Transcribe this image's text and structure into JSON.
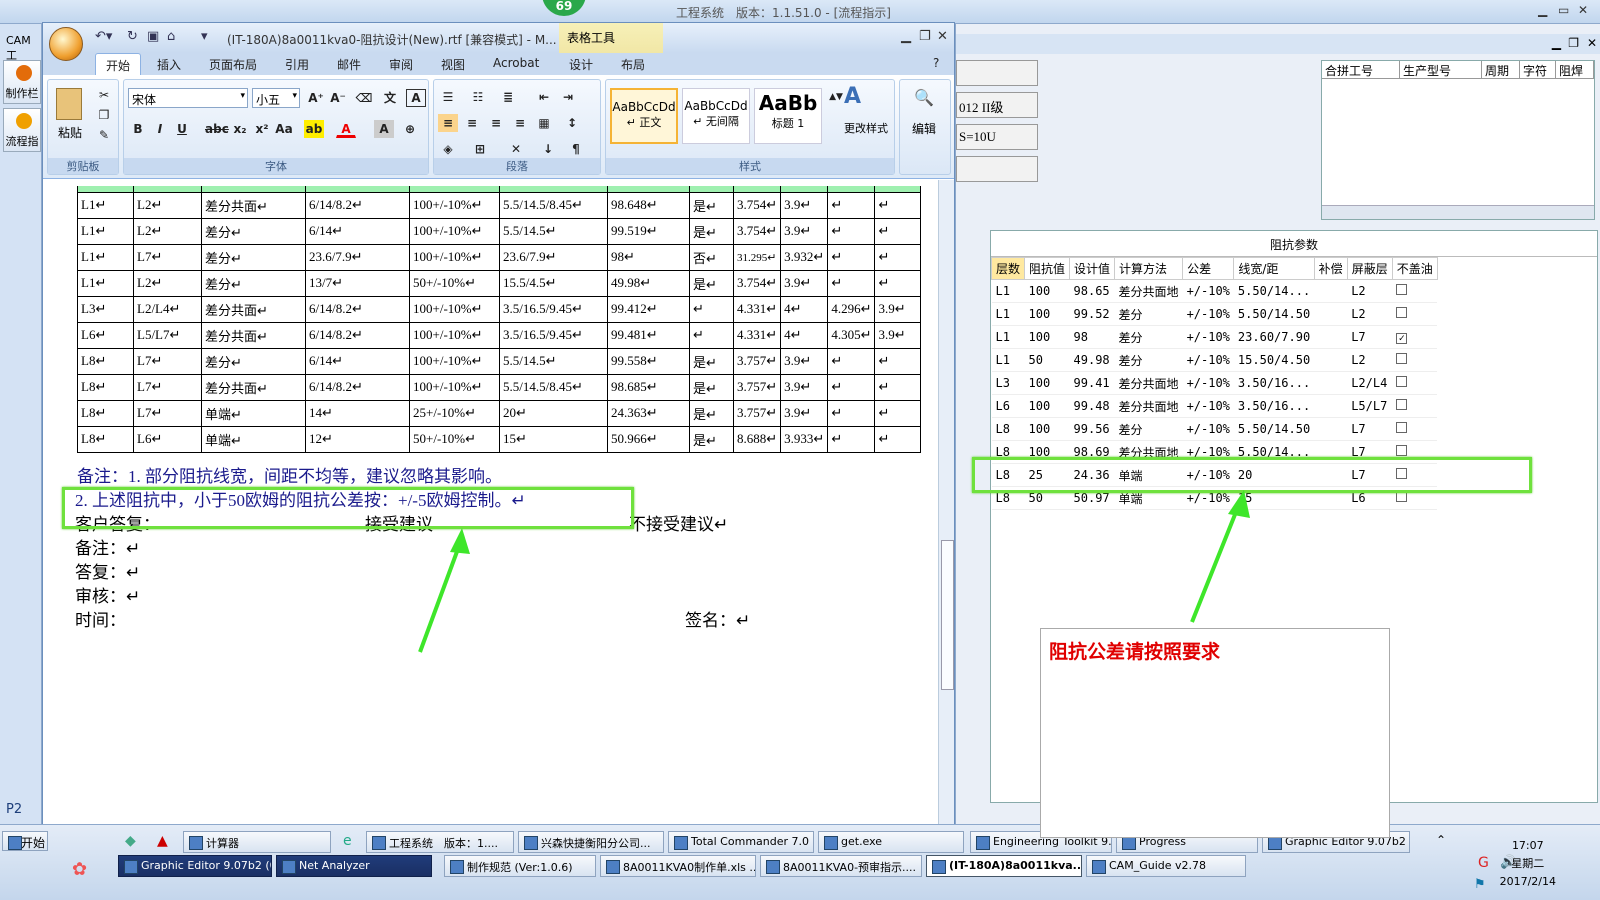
{
  "badge": "69",
  "cam": {
    "title": "工程系统　版本：1.1.51.0 - [流程指示]",
    "app_label": "CAM工",
    "side_buttons": [
      "制作栏",
      "流程指"
    ],
    "page_label": "P2",
    "fields": [
      "",
      "012 II级",
      "S=10U",
      ""
    ],
    "merge_headers": [
      "合拼工号",
      "生产型号",
      "周期",
      "字符",
      "阻焊"
    ],
    "imp_caption": "阻抗参数",
    "imp_headers": [
      "层数",
      "阻抗值",
      "设计值",
      "计算方法",
      "公差",
      "线宽/距",
      "补偿",
      "屏蔽层",
      "不盖油"
    ],
    "imp_rows": [
      [
        "L1",
        "100",
        "98.65",
        "差分共面地",
        "+/-10%",
        "5.50/14...",
        "",
        "L2",
        false
      ],
      [
        "L1",
        "100",
        "99.52",
        "差分",
        "+/-10%",
        "5.50/14.50",
        "",
        "L2",
        false
      ],
      [
        "L1",
        "100",
        "98",
        "差分",
        "+/-10%",
        "23.60/7.90",
        "",
        "L7",
        true
      ],
      [
        "L1",
        "50",
        "49.98",
        "差分",
        "+/-10%",
        "15.50/4.50",
        "",
        "L2",
        false
      ],
      [
        "L3",
        "100",
        "99.41",
        "差分共面地",
        "+/-10%",
        "3.50/16...",
        "",
        "L2/L4",
        false
      ],
      [
        "L6",
        "100",
        "99.48",
        "差分共面地",
        "+/-10%",
        "3.50/16...",
        "",
        "L5/L7",
        false
      ],
      [
        "L8",
        "100",
        "99.56",
        "差分",
        "+/-10%",
        "5.50/14.50",
        "",
        "L7",
        false
      ],
      [
        "L8",
        "100",
        "98.69",
        "差分共面地",
        "+/-10%",
        "5.50/14...",
        "",
        "L7",
        false
      ],
      [
        "L8",
        "25",
        "24.36",
        "单端",
        "+/-10%",
        "20",
        "",
        "L7",
        false
      ],
      [
        "L8",
        "50",
        "50.97",
        "单端",
        "+/-10%",
        "15",
        "",
        "L6",
        false
      ]
    ]
  },
  "word": {
    "title": "(IT-180A)8a0011kva0-阻抗设计(New).rtf [兼容模式] - M...",
    "tools_label": "表格工具",
    "tabs": [
      "开始",
      "插入",
      "页面布局",
      "引用",
      "邮件",
      "审阅",
      "视图",
      "Acrobat",
      "设计",
      "布局"
    ],
    "font_name": "宋体",
    "font_size": "小五",
    "groups": {
      "clipboard": "剪贴板",
      "font": "字体",
      "paragraph": "段落",
      "styles": "样式",
      "edit": "编辑"
    },
    "paste_label": "粘贴",
    "change_styles": "更改样式",
    "styles": [
      {
        "preview": "AaBbCcDd",
        "name": "↵ 正文"
      },
      {
        "preview": "AaBbCcDd",
        "name": "↵ 无间隔"
      },
      {
        "preview": "AaBb",
        "name": "标题 1"
      }
    ],
    "table_rows": [
      [
        "L1↵",
        "L2↵",
        "差分共面↵",
        "6/14/8.2↵",
        "100+/-10%↵",
        "5.5/14.5/8.45↵",
        "98.648↵",
        "是↵",
        "3.754↵",
        "3.9↵",
        "↵",
        "↵"
      ],
      [
        "L1↵",
        "L2↵",
        "差分↵",
        "6/14↵",
        "100+/-10%↵",
        "5.5/14.5↵",
        "99.519↵",
        "是↵",
        "3.754↵",
        "3.9↵",
        "↵",
        "↵"
      ],
      [
        "L1↵",
        "L7↵",
        "差分↵",
        "23.6/7.9↵",
        "100+/-10%↵",
        "23.6/7.9↵",
        "98↵",
        "否↵",
        "31.295↵",
        "3.932↵",
        "↵",
        "↵"
      ],
      [
        "L1↵",
        "L2↵",
        "差分↵",
        "13/7↵",
        "50+/-10%↵",
        "15.5/4.5↵",
        "49.98↵",
        "是↵",
        "3.754↵",
        "3.9↵",
        "↵",
        "↵"
      ],
      [
        "L3↵",
        "L2/L4↵",
        "差分共面↵",
        "6/14/8.2↵",
        "100+/-10%↵",
        "3.5/16.5/9.45↵",
        "99.412↵",
        "↵",
        "4.331↵",
        "4↵",
        "4.296↵",
        "3.9↵"
      ],
      [
        "L6↵",
        "L5/L7↵",
        "差分共面↵",
        "6/14/8.2↵",
        "100+/-10%↵",
        "3.5/16.5/9.45↵",
        "99.481↵",
        "↵",
        "4.331↵",
        "4↵",
        "4.305↵",
        "3.9↵"
      ],
      [
        "L8↵",
        "L7↵",
        "差分↵",
        "6/14↵",
        "100+/-10%↵",
        "5.5/14.5↵",
        "99.558↵",
        "是↵",
        "3.757↵",
        "3.9↵",
        "↵",
        "↵"
      ],
      [
        "L8↵",
        "L7↵",
        "差分共面↵",
        "6/14/8.2↵",
        "100+/-10%↵",
        "5.5/14.5/8.45↵",
        "98.685↵",
        "是↵",
        "3.757↵",
        "3.9↵",
        "↵",
        "↵"
      ],
      [
        "L8↵",
        "L7↵",
        "单端↵",
        "14↵",
        "25+/-10%↵",
        "20↵",
        "24.363↵",
        "是↵",
        "3.757↵",
        "3.9↵",
        "↵",
        "↵"
      ],
      [
        "L8↵",
        "L6↵",
        "单端↵",
        "12↵",
        "50+/-10%↵",
        "15↵",
        "50.966↵",
        "是↵",
        "8.688↵",
        "3.933↵",
        "↵",
        "↵"
      ]
    ],
    "note1": "备注：1. 部分阻抗线宽，间距不均等，建议忽略其影响。",
    "note2": "2. 上述阻抗中，小于50欧姆的阻抗公差按：+/-5欧姆控制。↵",
    "reply": "客户答复：",
    "accept": "接受建议",
    "reject": "不接受建议↵",
    "remark": "备注：↵",
    "answer": "答复：↵",
    "review": "审核：↵",
    "time": "时间：",
    "sign": "签名：↵"
  },
  "annotation": {
    "text": "阻抗公差请按照要求",
    "color": "#e00000",
    "box_color": "#6fe13d",
    "arrow_color": "#3ee62a"
  },
  "taskbar": {
    "start": "开始",
    "row1": [
      "计算器",
      "工程系统　版本：1....",
      "兴森快捷衡阳分公司...",
      "Total Commander 7.0 ...",
      "get.exe",
      "Engineering Toolkit 9....",
      "Progress",
      "Graphic Editor 9.07b2 ..."
    ],
    "row2": [
      "Graphic Editor 9.07b2 (0...",
      "Net Analyzer",
      "制作规范 (Ver:1.0.6)",
      "8A0011KVA0制作单.xls ...",
      "8A0011KVA0-预审指示....",
      "(IT-180A)8a0011kva...",
      "CAM_Guide v2.78"
    ],
    "time": "17:07",
    "weekday": "星期二",
    "date": "2017/2/14"
  }
}
